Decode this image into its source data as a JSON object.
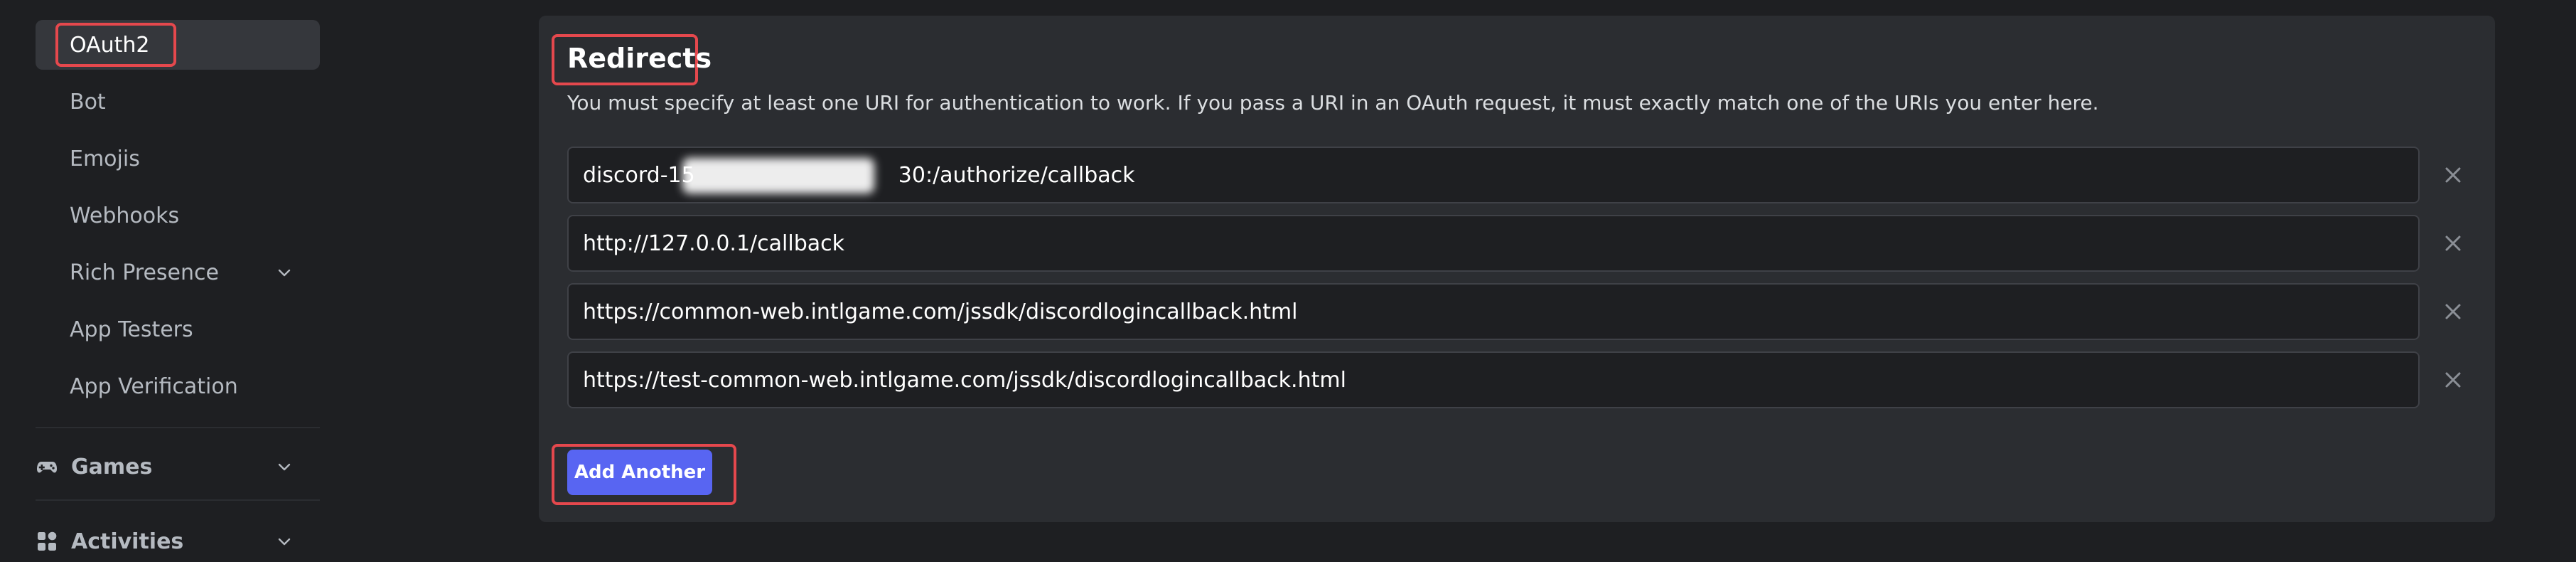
{
  "sidebar": {
    "items": [
      {
        "label": "OAuth2",
        "active": true
      },
      {
        "label": "Bot"
      },
      {
        "label": "Emojis"
      },
      {
        "label": "Webhooks"
      },
      {
        "label": "Rich Presence",
        "expandable": true
      },
      {
        "label": "App Testers"
      },
      {
        "label": "App Verification"
      }
    ],
    "sections": [
      {
        "label": "Games",
        "icon": "gamepad-icon"
      },
      {
        "label": "Activities",
        "icon": "activities-icon"
      }
    ]
  },
  "redirects": {
    "title": "Redirects",
    "description": "You must specify at least one URI for authentication to work. If you pass a URI in an OAuth request, it must exactly match one of the URIs you enter here.",
    "uris": [
      {
        "value": "discord-15                              30:/authorize/callback",
        "redacted": true
      },
      {
        "value": "http://127.0.0.1/callback"
      },
      {
        "value": "https://common-web.intlgame.com/jssdk/discordlogincallback.html"
      },
      {
        "value": "https://test-common-web.intlgame.com/jssdk/discordlogincallback.html"
      }
    ],
    "add_label": "Add Another"
  },
  "colors": {
    "background": "#1e1f22",
    "panel": "#2b2d31",
    "accent": "#5865f2",
    "highlight": "#e5484d"
  }
}
